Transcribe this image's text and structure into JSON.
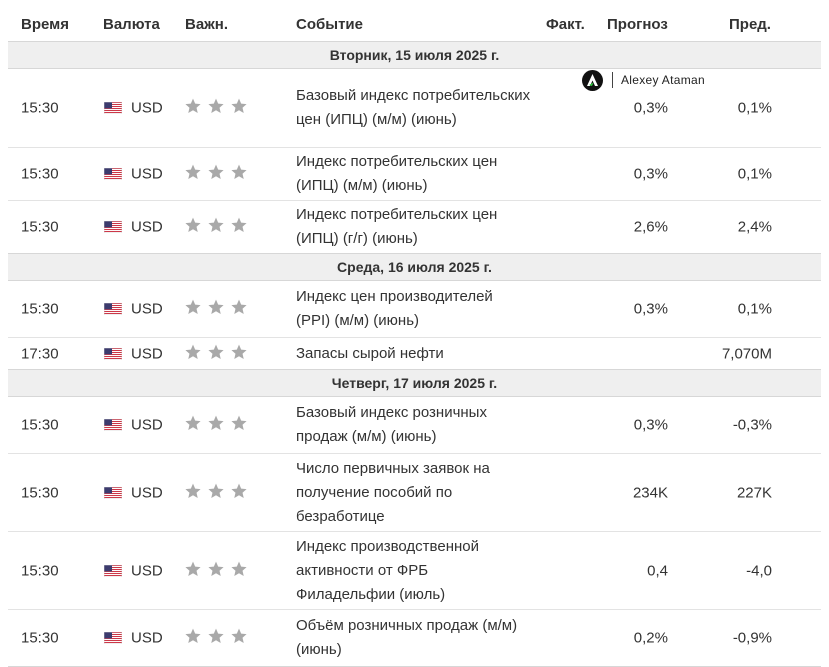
{
  "header": {
    "time": "Время",
    "currency": "Валюта",
    "importance": "Важн.",
    "event": "Событие",
    "actual": "Факт.",
    "forecast": "Прогноз",
    "previous": "Пред."
  },
  "watermark": {
    "name": "Alexey Ataman",
    "icon": "logo-triangle-icon"
  },
  "colors": {
    "day_bg": "#efefef",
    "star": "#a9a9a9",
    "text": "#333333"
  },
  "days": [
    {
      "label": "Вторник, 15 июля 2025 г.",
      "events": [
        {
          "time": "15:30",
          "currency": "USD",
          "stars": 3,
          "event": "Базовый индекс потребительских цен (ИПЦ) (м/м) (июнь)",
          "actual": "",
          "forecast": "0,3%",
          "previous": "0,1%"
        },
        {
          "time": "15:30",
          "currency": "USD",
          "stars": 3,
          "event": "Индекс потребительских цен (ИПЦ) (м/м) (июнь)",
          "actual": "",
          "forecast": "0,3%",
          "previous": "0,1%"
        },
        {
          "time": "15:30",
          "currency": "USD",
          "stars": 3,
          "event": "Индекс потребительских цен (ИПЦ) (г/г) (июнь)",
          "actual": "",
          "forecast": "2,6%",
          "previous": "2,4%"
        }
      ]
    },
    {
      "label": "Среда, 16 июля 2025 г.",
      "events": [
        {
          "time": "15:30",
          "currency": "USD",
          "stars": 3,
          "event": "Индекс цен производителей (PPI) (м/м) (июнь)",
          "actual": "",
          "forecast": "0,3%",
          "previous": "0,1%"
        },
        {
          "time": "17:30",
          "currency": "USD",
          "stars": 3,
          "event": "Запасы сырой нефти",
          "actual": "",
          "forecast": "",
          "previous": "7,070M"
        }
      ]
    },
    {
      "label": "Четверг, 17 июля 2025 г.",
      "events": [
        {
          "time": "15:30",
          "currency": "USD",
          "stars": 3,
          "event": "Базовый индекс розничных продаж (м/м) (июнь)",
          "actual": "",
          "forecast": "0,3%",
          "previous": "-0,3%"
        },
        {
          "time": "15:30",
          "currency": "USD",
          "stars": 3,
          "event": "Число первичных заявок на получение пособий по безработице",
          "actual": "",
          "forecast": "234K",
          "previous": "227K"
        },
        {
          "time": "15:30",
          "currency": "USD",
          "stars": 3,
          "event": "Индекс производственной активности от ФРБ Филадельфии (июль)",
          "actual": "",
          "forecast": "0,4",
          "previous": "-4,0"
        },
        {
          "time": "15:30",
          "currency": "USD",
          "stars": 3,
          "event": "Объём розничных продаж (м/м) (июнь)",
          "actual": "",
          "forecast": "0,2%",
          "previous": "-0,9%"
        }
      ]
    }
  ]
}
